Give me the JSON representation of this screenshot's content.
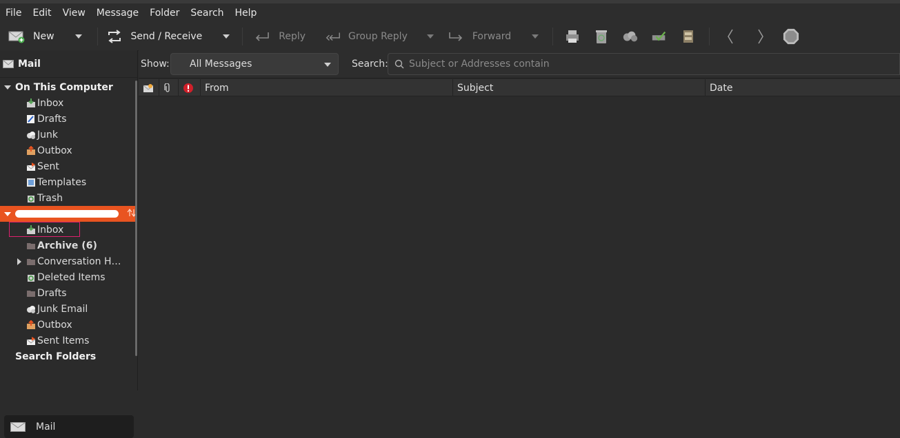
{
  "menu": [
    "File",
    "Edit",
    "View",
    "Message",
    "Folder",
    "Search",
    "Help"
  ],
  "toolbar": {
    "new_label": "New",
    "send_receive_label": "Send / Receive",
    "reply_label": "Reply",
    "group_reply_label": "Group Reply",
    "forward_label": "Forward"
  },
  "sidebar": {
    "header": "Mail",
    "local_group": "On This Computer",
    "local_items": [
      "Inbox",
      "Drafts",
      "Junk",
      "Outbox",
      "Sent",
      "Templates",
      "Trash"
    ],
    "account_items": [
      "Inbox",
      "Archive (6)",
      "Conversation H…",
      "Deleted Items",
      "Drafts",
      "Junk Email",
      "Outbox",
      "Sent Items"
    ],
    "search_folders": "Search Folders",
    "switcher_label": "Mail"
  },
  "filter": {
    "show_label": "Show:",
    "show_value": "All Messages",
    "search_label": "Search:",
    "search_placeholder": "Subject or Addresses contain"
  },
  "columns": [
    "From",
    "Subject",
    "Date"
  ],
  "colors": {
    "accent": "#e95420",
    "highlight_box": "#e0206e",
    "important": "#d0202a"
  }
}
